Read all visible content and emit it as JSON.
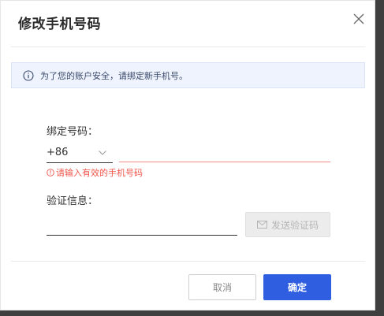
{
  "dialog": {
    "title": "修改手机号码"
  },
  "notice": {
    "text": "为了您的账户安全，请绑定新手机号。",
    "icon": "info-icon"
  },
  "form": {
    "phone_label": "绑定号码：",
    "country_code": "+86",
    "phone_value": "",
    "phone_error": "请输入有效的手机号码",
    "code_label": "验证信息：",
    "code_value": "",
    "send_code_label": "发送验证码",
    "send_code_icon": "mail-icon"
  },
  "footer": {
    "cancel_label": "取消",
    "confirm_label": "确定"
  },
  "colors": {
    "primary": "#2f5fe0",
    "error": "#f0554a",
    "notice_bg": "#eef3fd",
    "disabled_bg": "#ececec"
  }
}
